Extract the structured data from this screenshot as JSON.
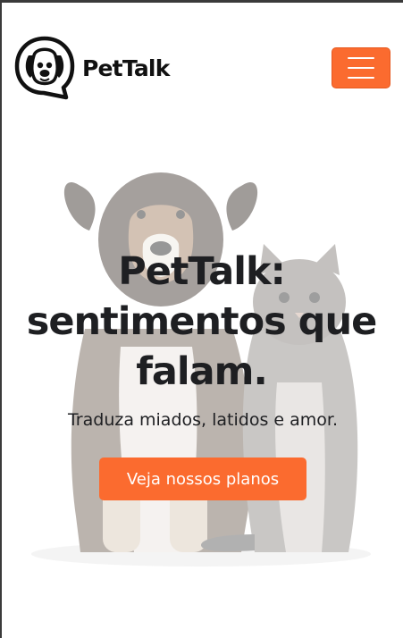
{
  "header": {
    "logo_text": "PetTalk",
    "menu_icon": "hamburger-menu-icon",
    "logo_icon": "dog-chat-bubble-icon"
  },
  "hero": {
    "title_line1": "PetTalk:",
    "title_line2": "sentimentos que",
    "title_line3": "falam.",
    "subtitle": "Traduza miados, latidos e amor.",
    "cta_label": "Veja nossos planos",
    "background_image": "dog-and-cat-photo"
  },
  "colors": {
    "accent": "#fb6b2f",
    "text": "#1e1f22",
    "background": "#ffffff"
  }
}
